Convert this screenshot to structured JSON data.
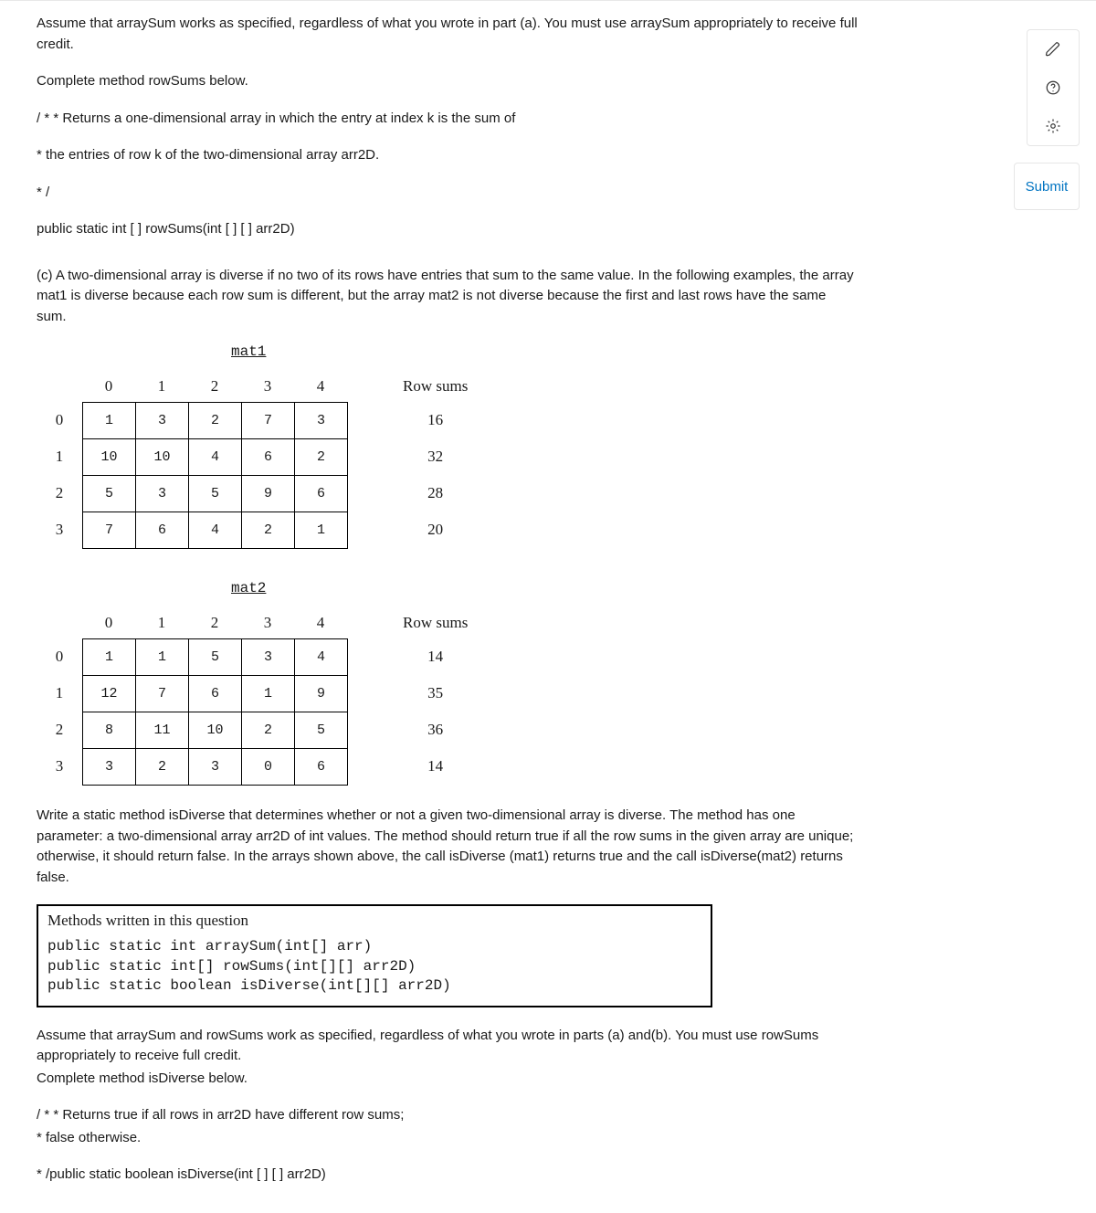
{
  "intro": {
    "p1": "Assume that arraySum works as specified, regardless of what you wrote in part (a). You must use arraySum appropriately to receive full credit.",
    "p2": "Complete method rowSums below.",
    "p3": "/ * * Returns a one-dimensional array in which the entry at index k is the sum of",
    "p4": "* the entries of row k of the two-dimensional array arr2D.",
    "p5": "* /",
    "p6": "public static int [ ] rowSums(int [ ] [ ] arr2D)"
  },
  "partC": {
    "desc": "(c) A two-dimensional array is diverse if no two of its rows have entries that sum to the same value. In the following examples, the array mat1 is diverse because each row sum is different, but the array mat2 is not diverse because the first and last rows have the same sum."
  },
  "mat1": {
    "title": "mat1",
    "colLabels": [
      "0",
      "1",
      "2",
      "3",
      "4"
    ],
    "rowLabels": [
      "0",
      "1",
      "2",
      "3"
    ],
    "rows": [
      [
        "1",
        "3",
        "2",
        "7",
        "3"
      ],
      [
        "10",
        "10",
        "4",
        "6",
        "2"
      ],
      [
        "5",
        "3",
        "5",
        "9",
        "6"
      ],
      [
        "7",
        "6",
        "4",
        "2",
        "1"
      ]
    ],
    "sumsHeader": "Row sums",
    "sums": [
      "16",
      "32",
      "28",
      "20"
    ]
  },
  "mat2": {
    "title": "mat2",
    "colLabels": [
      "0",
      "1",
      "2",
      "3",
      "4"
    ],
    "rowLabels": [
      "0",
      "1",
      "2",
      "3"
    ],
    "rows": [
      [
        "1",
        "1",
        "5",
        "3",
        "4"
      ],
      [
        "12",
        "7",
        "6",
        "1",
        "9"
      ],
      [
        "8",
        "11",
        "10",
        "2",
        "5"
      ],
      [
        "3",
        "2",
        "3",
        "0",
        "6"
      ]
    ],
    "sumsHeader": "Row sums",
    "sums": [
      "14",
      "35",
      "36",
      "14"
    ]
  },
  "after": {
    "p1": "Write a static method isDiverse that determines whether or not a given two-dimensional array is diverse. The method has one parameter: a two-dimensional array arr2D of int values. The method should return true if all the row sums in the given array are unique; otherwise, it should return false. In the arrays shown above, the call isDiverse (mat1) returns true and the call isDiverse(mat2) returns false."
  },
  "methodsBox": {
    "title": "Methods written in this question",
    "code": "public static int arraySum(int[] arr)\npublic static int[] rowSums(int[][] arr2D)\npublic static boolean isDiverse(int[][] arr2D)"
  },
  "closing": {
    "p1": "Assume that arraySum and rowSums work as specified, regardless of what you wrote in parts (a) and(b). You must use rowSums appropriately to receive full credit.",
    "p2": "Complete method isDiverse below.",
    "p3": "/ * * Returns true if all rows in arr2D have different row sums;",
    "p4": "* false otherwise.",
    "p5": "* /public static boolean isDiverse(int [ ] [ ] arr2D)"
  },
  "toolbar": {
    "submit": "Submit"
  }
}
